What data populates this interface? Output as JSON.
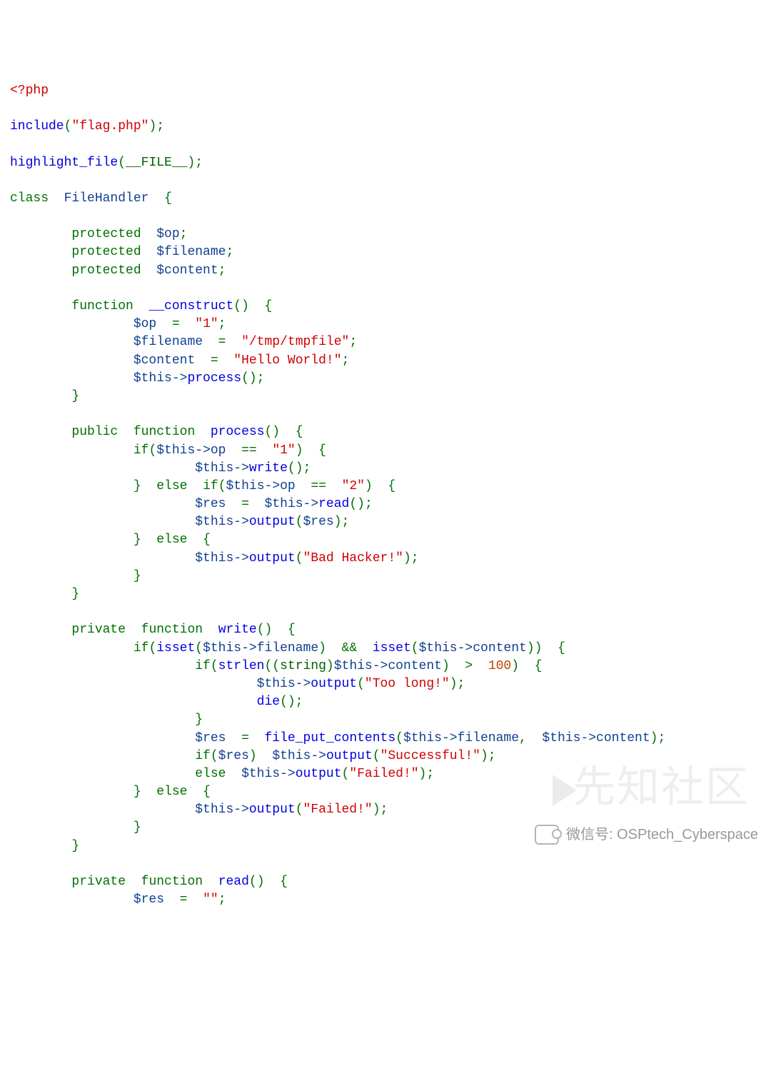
{
  "code": {
    "open_tag": "<?php",
    "include_fn": "include",
    "include_arg": "\"flag.php\"",
    "highlight_fn": "highlight_file",
    "file_const": "__FILE__",
    "class_kw": "class",
    "class_name": "FileHandler",
    "protected_kw": "protected",
    "prop_op": "$op",
    "prop_filename": "$filename",
    "prop_content": "$content",
    "function_kw": "function",
    "construct_name": "__construct",
    "op_assign": "$op",
    "op_val": "\"1\"",
    "filename_assign": "$filename",
    "filename_val": "\"/tmp/tmpfile\"",
    "content_assign": "$content",
    "content_val": "\"Hello World!\"",
    "this": "$this",
    "process_name": "process",
    "public_kw": "public",
    "if_kw": "if",
    "else_kw": "else",
    "op_prop": "op",
    "cmp1": "\"1\"",
    "cmp2": "\"2\"",
    "write_name": "write",
    "res_var": "$res",
    "read_name": "read",
    "output_name": "output",
    "bad_hacker": "\"Bad Hacker!\"",
    "private_kw": "private",
    "isset_fn": "isset",
    "filename_prop": "filename",
    "content_prop": "content",
    "strlen_fn": "strlen",
    "string_cast": "string",
    "hundred": "100",
    "too_long": "\"Too long!\"",
    "die_fn": "die",
    "file_put_contents_fn": "file_put_contents",
    "successful": "\"Successful!\"",
    "failed": "\"Failed!\"",
    "amp": "&&",
    "empty_str": "\"\""
  },
  "watermark": {
    "bg_text": "先知社区",
    "label": "微信号: OSPtech_Cyberspace"
  }
}
